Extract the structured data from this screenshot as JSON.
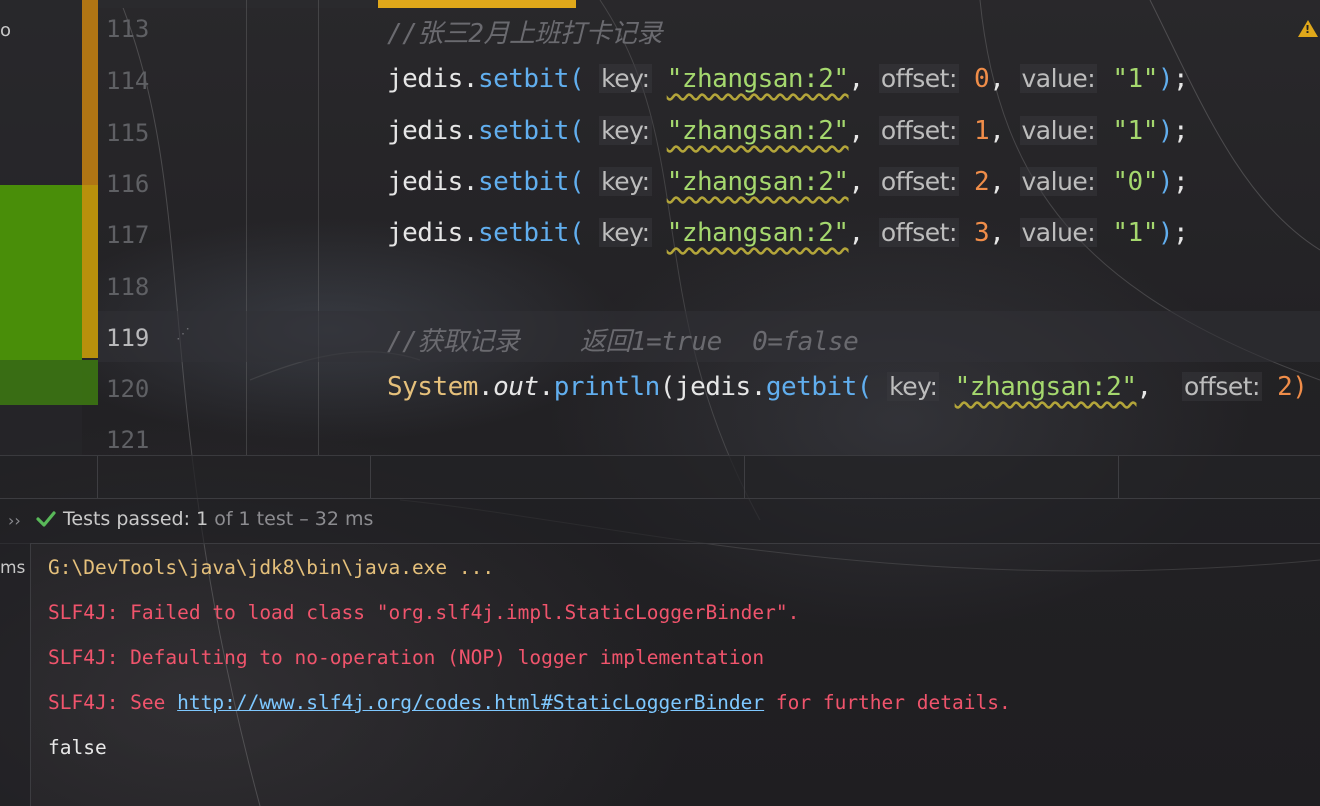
{
  "editor": {
    "line_numbers": [
      "113",
      "114",
      "115",
      "116",
      "117",
      "118",
      "119",
      "120",
      "121"
    ],
    "current_line": "119",
    "lines": [
      {
        "comment": "//张三2月上班打卡记录"
      },
      {
        "obj": "jedis",
        "method": "setbit",
        "key_hint": "key:",
        "key": "\"zhangsan:2\"",
        "offset_hint": "offset:",
        "offset": "0",
        "value_hint": "value:",
        "value": "\"1\""
      },
      {
        "obj": "jedis",
        "method": "setbit",
        "key_hint": "key:",
        "key": "\"zhangsan:2\"",
        "offset_hint": "offset:",
        "offset": "1",
        "value_hint": "value:",
        "value": "\"1\""
      },
      {
        "obj": "jedis",
        "method": "setbit",
        "key_hint": "key:",
        "key": "\"zhangsan:2\"",
        "offset_hint": "offset:",
        "offset": "2",
        "value_hint": "value:",
        "value": "\"0\""
      },
      {
        "obj": "jedis",
        "method": "setbit",
        "key_hint": "key:",
        "key": "\"zhangsan:2\"",
        "offset_hint": "offset:",
        "offset": "3",
        "value_hint": "value:",
        "value": "\"1\""
      },
      {},
      {
        "comment": "//获取记录    返回1=true  0=false"
      },
      {
        "sys": "System",
        "out": "out",
        "println": "println",
        "obj": "jedis",
        "method": "getbit",
        "key_hint": "key:",
        "key": "\"zhangsan:2\"",
        "offset_hint": "offset:",
        "offset": "2)"
      }
    ],
    "left_label": "o",
    "warning_icon": "warning-triangle-icon"
  },
  "run_panel": {
    "status_icon": "check-icon",
    "status_label": "Tests passed:",
    "status_count": "1",
    "status_rest": "of 1 test – 32 ms",
    "side_label": "ms",
    "console": {
      "line1": "G:\\DevTools\\java\\jdk8\\bin\\java.exe ...",
      "line2": "SLF4J: Failed to load class \"org.slf4j.impl.StaticLoggerBinder\".",
      "line3": "SLF4J: Defaulting to no-operation (NOP) logger implementation",
      "line4_prefix": "SLF4J: See ",
      "line4_link": "http://www.slf4j.org/codes.html#StaticLoggerBinder",
      "line4_suffix": " for further details.",
      "line5": "false"
    }
  },
  "colors": {
    "accent": "#e0a81a",
    "green_change": "#4e9a06",
    "error_text": "#f0546c",
    "link": "#7ec8ff"
  }
}
